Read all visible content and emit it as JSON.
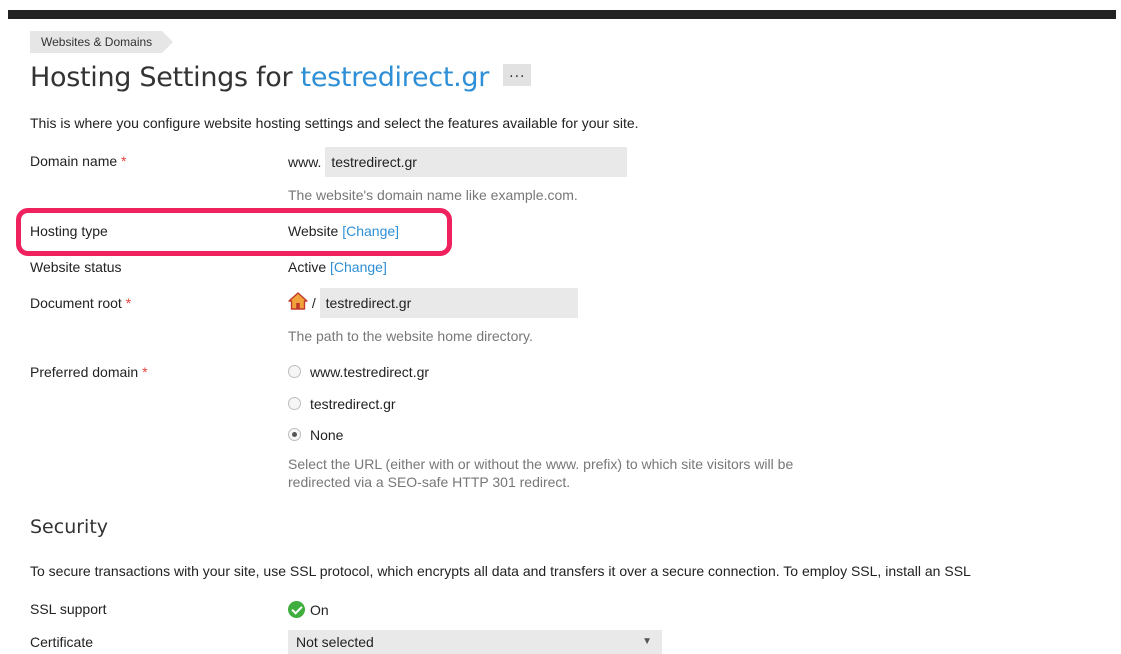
{
  "breadcrumb": {
    "item": "Websites & Domains"
  },
  "header": {
    "title_prefix": "Hosting Settings for ",
    "domain": "testredirect.gr",
    "more_label": "..."
  },
  "intro": "This is where you configure website hosting settings and select the features available for your site.",
  "domain_name": {
    "label": "Domain name",
    "required": "*",
    "prefix": "www.",
    "value": "testredirect.gr",
    "hint": "The website's domain name like example.com."
  },
  "hosting_type": {
    "label": "Hosting type",
    "value": "Website",
    "change": "[Change]"
  },
  "website_status": {
    "label": "Website status",
    "value": "Active",
    "change": "[Change]"
  },
  "document_root": {
    "label": "Document root",
    "required": "*",
    "separator": "/",
    "value": "testredirect.gr",
    "hint": "The path to the website home directory."
  },
  "preferred_domain": {
    "label": "Preferred domain",
    "required": "*",
    "options": [
      {
        "label": "www.testredirect.gr",
        "checked": false
      },
      {
        "label": "testredirect.gr",
        "checked": false
      },
      {
        "label": "None",
        "checked": true
      }
    ],
    "hint_line1": "Select the URL (either with or without the www. prefix) to which site visitors will be",
    "hint_line2": "redirected via a SEO-safe HTTP 301 redirect."
  },
  "security": {
    "heading": "Security",
    "description": "To secure transactions with your site, use SSL protocol, which encrypts all data and transfers it over a secure connection. To employ SSL, install an SSL",
    "ssl_label": "SSL support",
    "ssl_value": "On",
    "certificate_label": "Certificate",
    "certificate_value": "Not selected"
  },
  "colors": {
    "accent": "#2e8fd6",
    "required": "#e8413d",
    "highlight": "#f0215f",
    "success": "#3fae3f"
  },
  "icons": {
    "home": "home-icon",
    "check": "check-circle-icon",
    "more": "more-icon"
  }
}
